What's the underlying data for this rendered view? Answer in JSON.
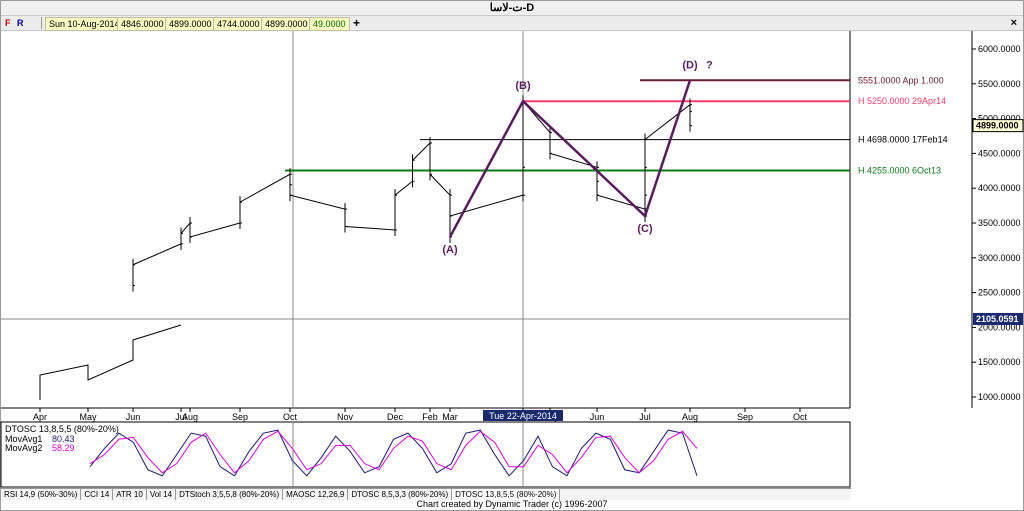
{
  "window": {
    "title": "ت-لاسا-D"
  },
  "toolbar": {
    "f_label": "F",
    "r_label": "R",
    "date": "Sun 10-Aug-2014",
    "open": "4846.0000",
    "high": "4899.0000",
    "low": "4744.0000",
    "close": "4899.0000",
    "change": "49.0000",
    "close_label": "×"
  },
  "colors": {
    "wave": "#5a1a5e",
    "resistance_red": "#ff3b6b",
    "support_green": "#0a7a18",
    "target_maroon": "#6e1a30",
    "neutral_line": "#000000",
    "osc_main": "#1a1a6e",
    "osc_avg": "#e000e0",
    "last_price_bg": "#ffffd8",
    "upper_pane_price_bg": "#1a2a6e"
  },
  "chart_data": [
    {
      "type": "line",
      "title": "",
      "series": [
        {
          "points": [
            [
              "Jun 2013",
              2600
            ],
            [
              "Jun 2013",
              2900
            ],
            [
              "Jul 2013",
              3200
            ],
            [
              "Jul 2013",
              3350
            ],
            [
              "Aug 2013",
              3500
            ],
            [
              "Aug 2013",
              3300
            ],
            [
              "Sep 2013",
              3500
            ],
            [
              "Sep 2013",
              3800
            ],
            [
              "Oct 2013",
              4200
            ],
            [
              "Oct 2013",
              4050
            ],
            [
              "Oct 2013",
              3900
            ],
            [
              "Nov 2013",
              3700
            ],
            [
              "Nov 2013",
              3450
            ],
            [
              "Dec 2013",
              3400
            ],
            [
              "Dec 2013",
              3900
            ],
            [
              "Jan 2014",
              4100
            ],
            [
              "Jan 2014",
              4400
            ],
            [
              "Feb 2014",
              4650
            ],
            [
              "Feb 2014",
              4200
            ],
            [
              "Mar 2014",
              3900
            ],
            [
              "Mar 2014",
              3300
            ],
            [
              "Mar 2014",
              3600
            ],
            [
              "Apr 2014",
              3900
            ],
            [
              "Apr 2014",
              4300
            ],
            [
              "Apr 2014",
              5250
            ],
            [
              "May 2014",
              4800
            ],
            [
              "May 2014",
              4500
            ],
            [
              "Jun 2014",
              4300
            ],
            [
              "Jun 2014",
              4100
            ],
            [
              "Jun 2014",
              3900
            ],
            [
              "Jul 2014",
              3700
            ],
            [
              "Jul 2014",
              3600
            ],
            [
              "Jul 2014",
              3900
            ],
            [
              "Jul 2014",
              4300
            ],
            [
              "Jul 2014",
              4700
            ],
            [
              "Aug 2014",
              5200
            ],
            [
              "Aug 2014",
              5100
            ],
            [
              "Aug 2014",
              4899
            ]
          ]
        }
      ],
      "lower_pane_points": [
        [
          "Mar 2013",
          1000
        ],
        [
          "Apr 2013",
          1150
        ],
        [
          "Apr 2013",
          1250
        ],
        [
          "May 2013",
          1350
        ],
        [
          "May 2013",
          1300
        ],
        [
          "May 2013",
          1200
        ],
        [
          "Jun 2013",
          1400
        ],
        [
          "Jun 2013",
          1600
        ],
        [
          "Jul 2013",
          1750
        ]
      ],
      "y_ticks": [
        "6000.0000",
        "5500.0000",
        "5000.0000",
        "4500.0000",
        "4000.0000",
        "3500.0000",
        "3000.0000",
        "2500.0000",
        "2000.0000",
        "1500.0000",
        "1000.0000"
      ],
      "y_tick_values": [
        6000,
        5500,
        5000,
        4500,
        4000,
        3500,
        3000,
        2500,
        2000,
        1500,
        1000
      ],
      "x_ticks": [
        "Apr",
        "May",
        "Jun",
        "Jul",
        "Aug",
        "Sep",
        "Oct",
        "Nov",
        "Dec",
        "Feb",
        "Mar",
        "Apr",
        "May",
        "Jun",
        "Jul",
        "Aug",
        "Sep",
        "Oct"
      ],
      "x_tick_dates": [
        "Apr 2013",
        "May 2013",
        "Jun 2013",
        "Jul 2013",
        "Aug 2013",
        "Sep 2013",
        "Oct 2013",
        "Nov 2013",
        "Dec 2013",
        "Feb 2014",
        "Mar 2014",
        "Apr 2014",
        "May 2014",
        "Jun 2014",
        "Jul 2014",
        "Aug 2014",
        "Sep 2014",
        "Oct 2014"
      ],
      "cursor_date_label": "Tue 22-Apr-2014",
      "cursor_date": "Apr 2014",
      "last_price_label": "4899.0000",
      "upper_pane_price_label": "2105.0591",
      "wave_labels": [
        {
          "label": "(A)",
          "date": "Mar 2014",
          "value": 3300
        },
        {
          "label": "(B)",
          "date": "Apr 2014",
          "value": 5250
        },
        {
          "label": "(C)",
          "date": "Jul 2014",
          "value": 3600
        },
        {
          "label": "(D)",
          "date": "Aug 2014",
          "value": 5551
        }
      ],
      "wave_question_mark": "?",
      "horizontal_levels": [
        {
          "label": "5551.0000 App 1.000",
          "value": 5551,
          "color_key": "target_maroon"
        },
        {
          "label": "H 5250.0000 29Apr14",
          "value": 5250,
          "color_key": "resistance_red"
        },
        {
          "label": "H 4698.0000 17Feb14",
          "value": 4698,
          "color_key": "neutral_line"
        },
        {
          "label": "H 4255.0000 6Oct13",
          "value": 4255,
          "color_key": "support_green"
        }
      ],
      "grid": false,
      "legend": "none"
    },
    {
      "type": "line",
      "title": "DTOSC 13,8,5,5 (80%-20%)",
      "legend_entries": [
        {
          "name": "MovAvg1",
          "value": "80.43"
        },
        {
          "name": "MovAvg2",
          "value": "58.29"
        }
      ],
      "ylim": [
        0,
        100
      ],
      "series": [
        {
          "name": "DTOSC 13,8,5,5 (80%-20%)",
          "values": [
            30,
            60,
            85,
            70,
            25,
            15,
            50,
            85,
            80,
            30,
            15,
            55,
            85,
            90,
            40,
            15,
            45,
            80,
            55,
            20,
            30,
            75,
            85,
            60,
            20,
            35,
            85,
            90,
            50,
            15,
            40,
            80,
            30,
            15,
            60,
            85,
            75,
            25,
            20,
            55,
            90,
            85,
            15
          ]
        },
        {
          "name": "MovAvg1",
          "values": [
            35,
            50,
            75,
            78,
            45,
            20,
            35,
            70,
            85,
            50,
            20,
            40,
            75,
            88,
            60,
            25,
            35,
            65,
            65,
            35,
            25,
            60,
            80,
            72,
            35,
            25,
            65,
            88,
            70,
            30,
            30,
            65,
            50,
            20,
            45,
            78,
            80,
            45,
            20,
            40,
            75,
            88,
            60
          ]
        }
      ]
    }
  ],
  "bottom_tabs": [
    "RSI 14,9 (50%-30%)",
    "CCI 14",
    "ATR 10",
    "Vol 14",
    "DTStoch 3,5,5,8 (80%-20%)",
    "MAOSC 12,26,9",
    "DTOSC 8,5,3,3 (80%-20%)",
    "DTOSC 13,8,5,5 (80%-20%)"
  ],
  "active_tab_index": 7,
  "credit": "Chart created by Dynamic Trader  (c)  1996-2007"
}
